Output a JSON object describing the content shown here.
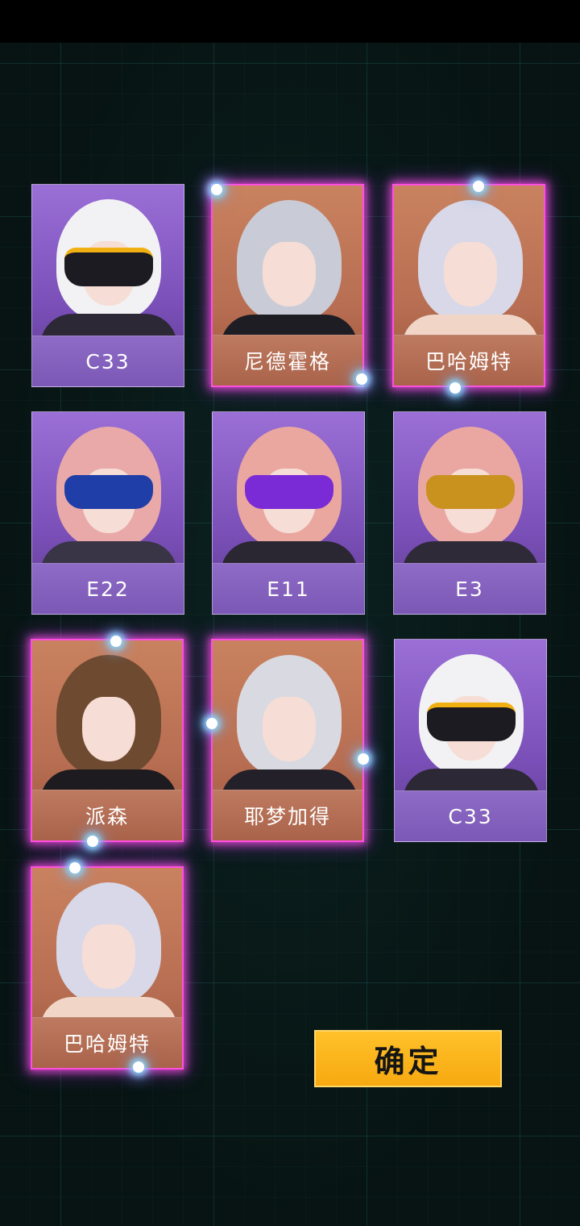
{
  "cards": [
    {
      "name": "C33",
      "theme": "purple",
      "selected": false
    },
    {
      "name": "尼德霍格",
      "theme": "orange",
      "selected": true
    },
    {
      "name": "巴哈姆特",
      "theme": "orange",
      "selected": true
    },
    {
      "name": "E22",
      "theme": "purple",
      "selected": false
    },
    {
      "name": "E11",
      "theme": "purple",
      "selected": false
    },
    {
      "name": "E3",
      "theme": "purple",
      "selected": false
    },
    {
      "name": "派森",
      "theme": "orange",
      "selected": true
    },
    {
      "name": "耶梦加得",
      "theme": "orange",
      "selected": true
    },
    {
      "name": "C33",
      "theme": "purple",
      "selected": false
    },
    {
      "name": "巴哈姆特",
      "theme": "orange",
      "selected": true
    }
  ],
  "confirm_label": "确定",
  "colors": {
    "accent": "#f7a910",
    "selection_glow": "#ff4fe0",
    "purple_card": "#7a4fb8",
    "orange_card": "#b86e52"
  }
}
